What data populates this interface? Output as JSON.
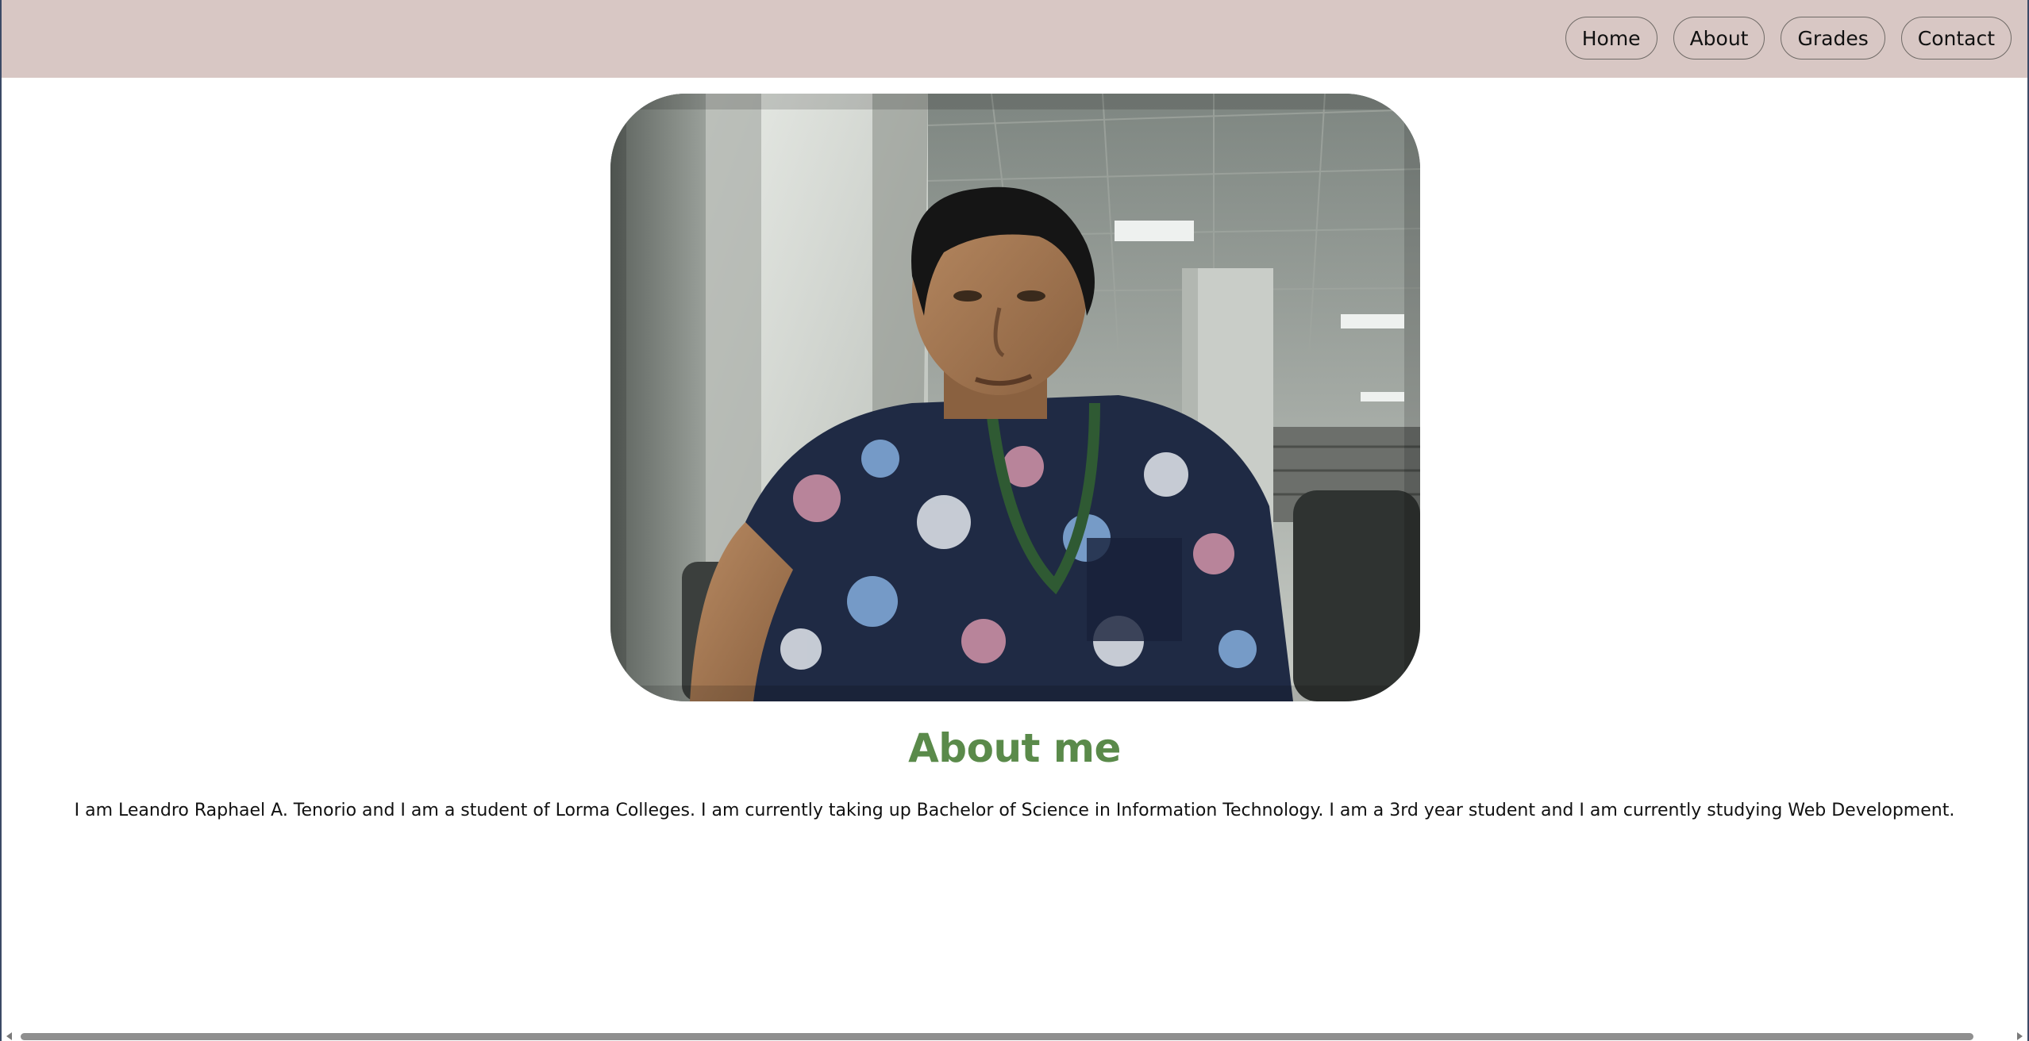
{
  "nav": {
    "items": [
      {
        "label": "Home"
      },
      {
        "label": "About"
      },
      {
        "label": "Grades"
      },
      {
        "label": "Contact"
      }
    ]
  },
  "profile_photo": {
    "icon": "person-photo"
  },
  "about": {
    "title": "About me",
    "text": "I am Leandro Raphael A. Tenorio and I am a student of Lorma Colleges. I am currently taking up Bachelor of Science in Information Technology. I am a 3rd year student and I am currently studying Web Development."
  },
  "colors": {
    "navbar": "#d8c7c4",
    "title": "#5a8a4a",
    "text": "#111111"
  }
}
